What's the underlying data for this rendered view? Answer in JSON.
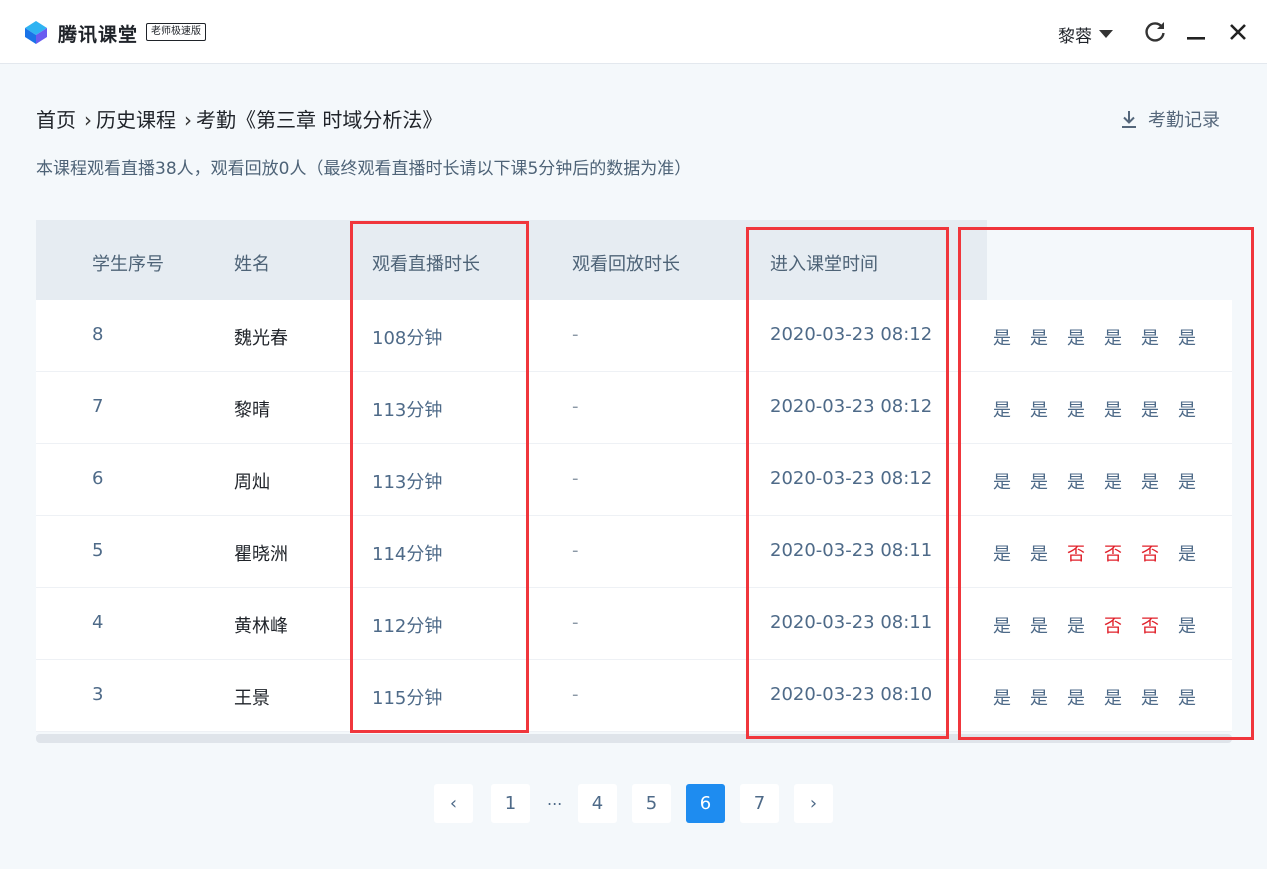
{
  "app": {
    "brand": "腾讯课堂",
    "edition": "老师极速版",
    "user": "黎蓉"
  },
  "breadcrumb": {
    "home": "首页",
    "history": "历史课程",
    "current": "考勤《第三章 时域分析法》"
  },
  "export_label": "考勤记录",
  "summary": "本课程观看直播38人，观看回放0人（最终观看直播时长请以下课5分钟后的数据为准）",
  "table": {
    "headers": [
      "学生序号",
      "姓名",
      "观看直播时长",
      "观看回放时长",
      "进入课堂时间"
    ],
    "rows": [
      {
        "id": "8",
        "name": "魏光春",
        "live": "108分钟",
        "replay": "-",
        "time": "2020-03-23 08:12",
        "flags": [
          "是",
          "是",
          "是",
          "是",
          "是",
          "是"
        ]
      },
      {
        "id": "7",
        "name": "黎晴",
        "live": "113分钟",
        "replay": "-",
        "time": "2020-03-23 08:12",
        "flags": [
          "是",
          "是",
          "是",
          "是",
          "是",
          "是"
        ]
      },
      {
        "id": "6",
        "name": "周灿",
        "live": "113分钟",
        "replay": "-",
        "time": "2020-03-23 08:12",
        "flags": [
          "是",
          "是",
          "是",
          "是",
          "是",
          "是"
        ]
      },
      {
        "id": "5",
        "name": "瞿晓洲",
        "live": "114分钟",
        "replay": "-",
        "time": "2020-03-23 08:11",
        "flags": [
          "是",
          "是",
          "否",
          "否",
          "否",
          "是"
        ]
      },
      {
        "id": "4",
        "name": "黄林峰",
        "live": "112分钟",
        "replay": "-",
        "time": "2020-03-23 08:11",
        "flags": [
          "是",
          "是",
          "是",
          "否",
          "否",
          "是"
        ]
      },
      {
        "id": "3",
        "name": "王景",
        "live": "115分钟",
        "replay": "-",
        "time": "2020-03-23 08:10",
        "flags": [
          "是",
          "是",
          "是",
          "是",
          "是",
          "是"
        ]
      }
    ]
  },
  "pagination": {
    "prev": "‹",
    "next": "›",
    "pages": [
      "1",
      "4",
      "5",
      "6",
      "7"
    ],
    "ellipsis": "...",
    "current": "6"
  },
  "colors": {
    "accent": "#1e8cf0",
    "negative": "#e0202a",
    "highlight": "#f0363c",
    "text_secondary": "#4e6a88"
  }
}
